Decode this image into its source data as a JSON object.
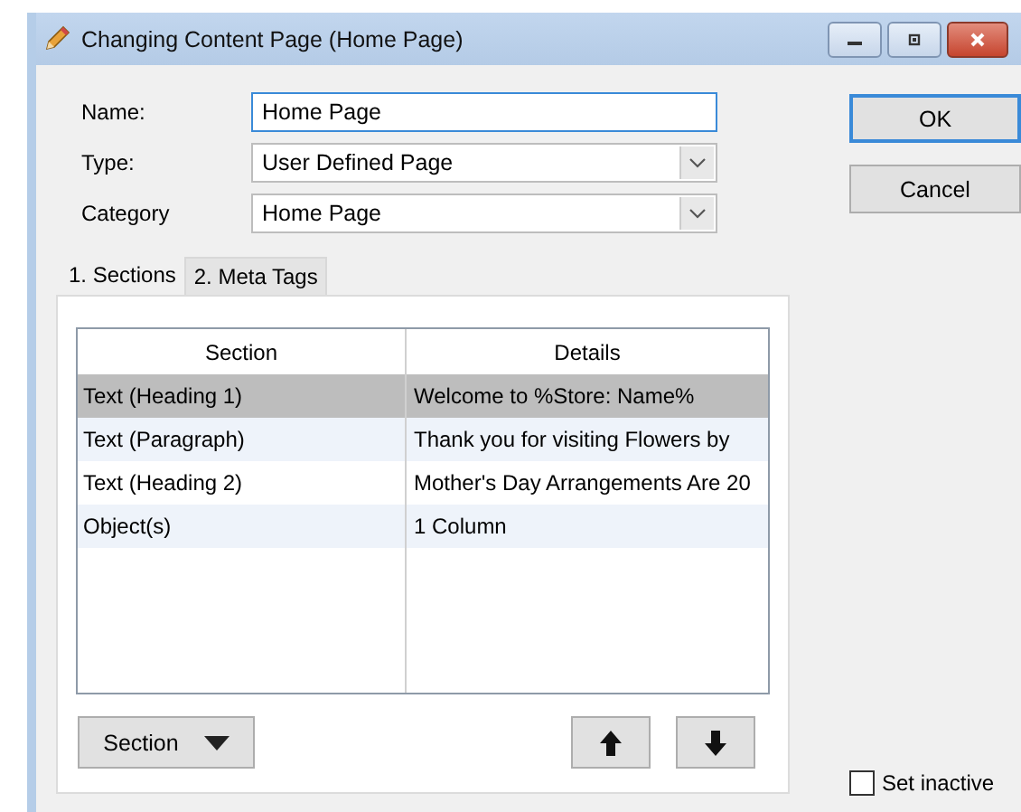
{
  "window": {
    "title": "Changing Content Page  (Home Page)"
  },
  "fields": [
    {
      "label": "Name:",
      "kind": "text",
      "value": "Home Page",
      "focused": true
    },
    {
      "label": "Type:",
      "kind": "dropdown",
      "value": "User Defined Page",
      "focused": false
    },
    {
      "label": "Category",
      "kind": "dropdown",
      "value": "Home Page",
      "focused": false
    }
  ],
  "buttons": [
    {
      "label": "OK",
      "default": true
    },
    {
      "label": "Cancel",
      "default": false
    }
  ],
  "tabs": [
    {
      "label": "1. Sections",
      "selected": true
    },
    {
      "label": "2. Meta Tags",
      "selected": false
    }
  ],
  "table": {
    "columns": [
      "Section",
      "Details"
    ],
    "rows": [
      {
        "cells": [
          "Text (Heading 1)",
          "Welcome to %Store: Name%"
        ],
        "selected": true
      },
      {
        "cells": [
          "Text (Paragraph)",
          "Thank you for visiting Flowers by"
        ],
        "selected": false
      },
      {
        "cells": [
          "Text (Heading 2)",
          "Mother's Day Arrangements Are 20"
        ],
        "selected": false
      },
      {
        "cells": [
          "Object(s)",
          "1 Column"
        ],
        "selected": false
      }
    ]
  },
  "section_button": {
    "label": "Section"
  },
  "set_inactive": {
    "label": "Set inactive",
    "checked": false
  }
}
